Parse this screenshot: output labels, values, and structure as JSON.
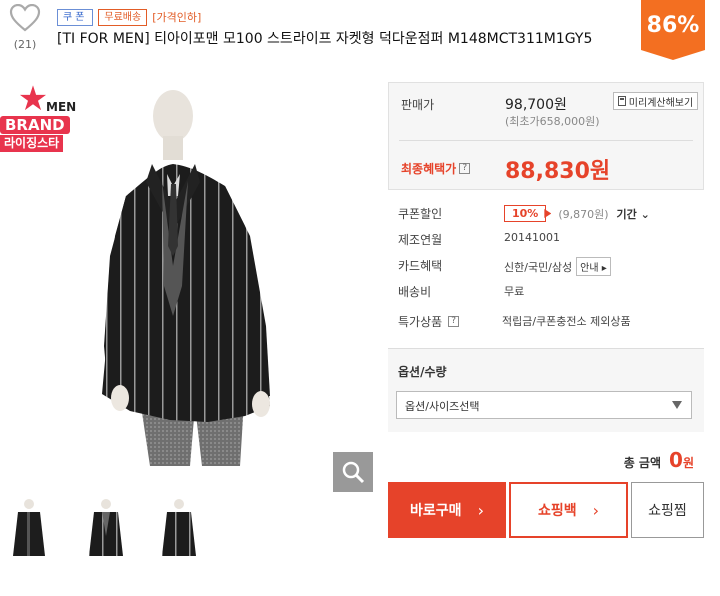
{
  "wish": {
    "count": "(21)"
  },
  "badges": {
    "coupon": "쿠폰",
    "freeship": "무료배송",
    "pricedown": "[가격인하]"
  },
  "product": {
    "title": "[TI FOR MEN] 티아이포맨 모100 스트라이프 자켓형 덕다운점퍼 M148MCT311M1GY5",
    "discount": "86%"
  },
  "brand_badge": {
    "en": "BRAND",
    "kr": "라이징스타",
    "brand_text": "MEN"
  },
  "price": {
    "sale_label": "판매가",
    "sale_price": "98,700원",
    "original_price": "(최초가658,000원)",
    "calc_button": "미리계산해보기",
    "final_label": "최종혜택가",
    "final_price": "88,830원"
  },
  "details": {
    "coupon_label": "쿠폰할인",
    "coupon_rate": "10%",
    "coupon_amount": "(9,870원)",
    "coupon_period": "기간",
    "made_label": "제조연월",
    "made_value": "20141001",
    "card_label": "카드혜택",
    "card_value": "신한/국민/삼성",
    "card_info_button": "안내",
    "ship_label": "배송비",
    "ship_value": "무료",
    "special_label": "특가상품",
    "special_value": "적립금/쿠폰충전소 제외상품"
  },
  "options": {
    "title": "옵션/수량",
    "select_value": "옵션/사이즈선택"
  },
  "total": {
    "label": "총 금액",
    "amount": "0",
    "unit": "원"
  },
  "buttons": {
    "buy": "바로구매",
    "cart": "쇼핑백",
    "wishlist": "쇼핑찜"
  },
  "colors": {
    "accent": "#e6432a",
    "badge": "#f36f21",
    "brand": "#e8344d"
  },
  "icons": [
    "heart-icon",
    "zoom-icon",
    "calculator-icon",
    "question-icon",
    "chevron-right-icon",
    "dropdown-arrow-icon"
  ]
}
